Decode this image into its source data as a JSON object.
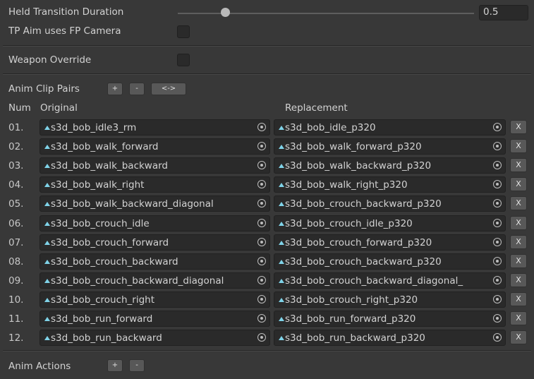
{
  "held_transition": {
    "label": "Held Transition Duration",
    "value": "0.5",
    "slider_fraction": 0.16
  },
  "tp_aim": {
    "label": "TP Aim uses FP Camera",
    "checked": false
  },
  "weapon_override": {
    "label": "Weapon Override",
    "checked": false
  },
  "anim_clip_pairs": {
    "label": "Anim Clip Pairs",
    "add_label": "+",
    "remove_label": "-",
    "swap_label": "<->",
    "col_num": "Num",
    "col_original": "Original",
    "col_replacement": "Replacement",
    "remove_row_label": "X",
    "rows": [
      {
        "num": "01.",
        "original": "s3d_bob_idle3_rm",
        "replacement": "s3d_bob_idle_p320"
      },
      {
        "num": "02.",
        "original": "s3d_bob_walk_forward",
        "replacement": "s3d_bob_walk_forward_p320"
      },
      {
        "num": "03.",
        "original": "s3d_bob_walk_backward",
        "replacement": "s3d_bob_walk_backward_p320"
      },
      {
        "num": "04.",
        "original": "s3d_bob_walk_right",
        "replacement": "s3d_bob_walk_right_p320"
      },
      {
        "num": "05.",
        "original": "s3d_bob_walk_backward_diagonal",
        "replacement": "s3d_bob_crouch_backward_p320"
      },
      {
        "num": "06.",
        "original": "s3d_bob_crouch_idle",
        "replacement": "s3d_bob_crouch_idle_p320"
      },
      {
        "num": "07.",
        "original": "s3d_bob_crouch_forward",
        "replacement": "s3d_bob_crouch_forward_p320"
      },
      {
        "num": "08.",
        "original": "s3d_bob_crouch_backward",
        "replacement": "s3d_bob_crouch_backward_p320"
      },
      {
        "num": "09.",
        "original": "s3d_bob_crouch_backward_diagonal",
        "replacement": "s3d_bob_crouch_backward_diagonal_"
      },
      {
        "num": "10.",
        "original": "s3d_bob_crouch_right",
        "replacement": "s3d_bob_crouch_right_p320"
      },
      {
        "num": "11.",
        "original": "s3d_bob_run_forward",
        "replacement": "s3d_bob_run_forward_p320"
      },
      {
        "num": "12.",
        "original": "s3d_bob_run_backward",
        "replacement": "s3d_bob_run_backward_p320"
      }
    ]
  },
  "anim_actions": {
    "label": "Anim Actions",
    "add_label": "+",
    "remove_label": "-"
  },
  "icons": {
    "clip": "animation-clip-icon",
    "picker": "object-picker-icon"
  },
  "colors": {
    "background": "#383838",
    "field": "#2a2a2a",
    "clip_icon": "#7fd3e8",
    "button": "#585858"
  }
}
